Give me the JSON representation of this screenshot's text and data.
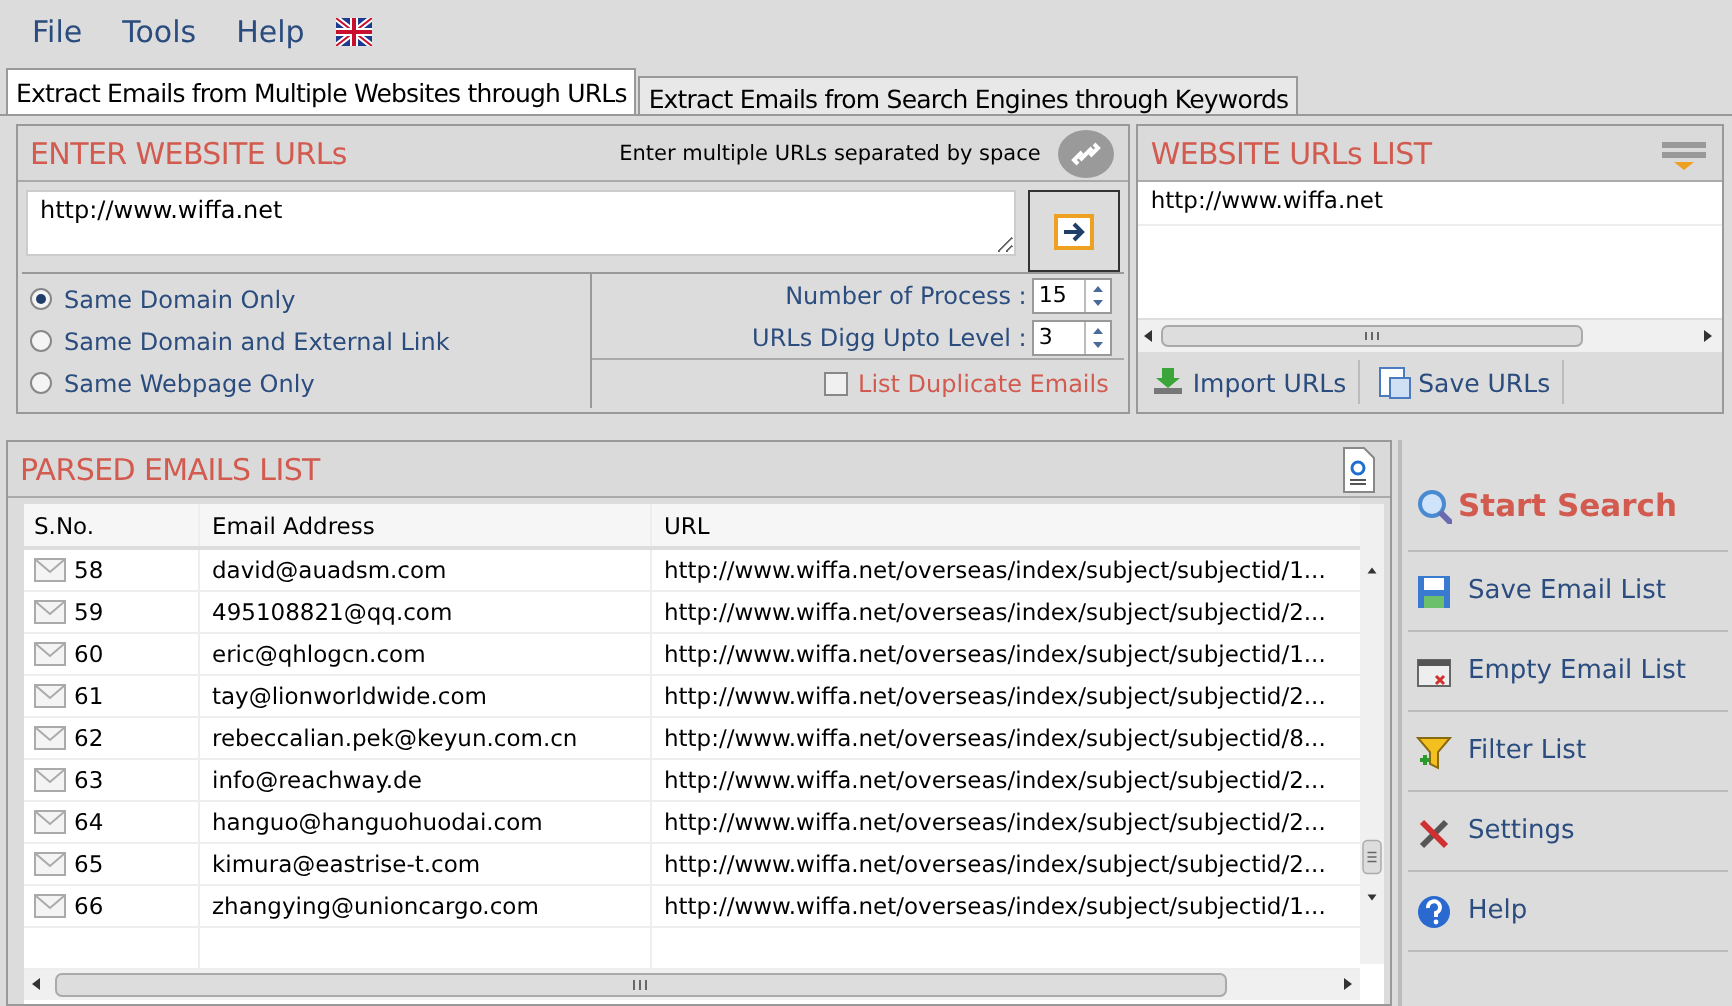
{
  "menu": [
    "File",
    "Tools",
    "Help"
  ],
  "tabs": [
    {
      "label": "Extract Emails from Multiple Websites through URLs",
      "selected": true
    },
    {
      "label": "Extract Emails from Search Engines through Keywords",
      "selected": false
    }
  ],
  "url_panel": {
    "title": "ENTER WEBSITE URLs",
    "hint": "Enter multiple URLs separated by space",
    "value": "http://www.wiffa.net"
  },
  "scope_options": [
    {
      "label": "Same Domain Only",
      "selected": true
    },
    {
      "label": "Same Domain and External Link",
      "selected": false
    },
    {
      "label": "Same Webpage Only",
      "selected": false
    }
  ],
  "spinners": [
    {
      "label": "Number of Process :",
      "value": "15"
    },
    {
      "label": "URLs Digg Upto Level :",
      "value": "3"
    }
  ],
  "list_duplicate": {
    "label": "List Duplicate Emails",
    "checked": false
  },
  "url_list": {
    "title": "WEBSITE URLs LIST",
    "items": [
      "http://www.wiffa.net"
    ],
    "buttons": [
      {
        "label": "Import URLs",
        "kind": "import"
      },
      {
        "label": "Save URLs",
        "kind": "save"
      }
    ]
  },
  "emails": {
    "title": "PARSED EMAILS LIST",
    "columns": [
      "S.No.",
      "Email Address",
      "URL"
    ],
    "rows": [
      {
        "sno": "58",
        "email": "david@auadsm.com",
        "url": "http://www.wiffa.net/overseas/index/subject/subjectid/1..."
      },
      {
        "sno": "59",
        "email": "495108821@qq.com",
        "url": "http://www.wiffa.net/overseas/index/subject/subjectid/2..."
      },
      {
        "sno": "60",
        "email": "eric@qhlogcn.com",
        "url": "http://www.wiffa.net/overseas/index/subject/subjectid/1..."
      },
      {
        "sno": "61",
        "email": "tay@lionworldwide.com",
        "url": "http://www.wiffa.net/overseas/index/subject/subjectid/2..."
      },
      {
        "sno": "62",
        "email": "rebeccalian.pek@keyun.com.cn",
        "url": "http://www.wiffa.net/overseas/index/subject/subjectid/8..."
      },
      {
        "sno": "63",
        "email": "info@reachway.de",
        "url": "http://www.wiffa.net/overseas/index/subject/subjectid/2..."
      },
      {
        "sno": "64",
        "email": "hanguo@hanguohuodai.com",
        "url": "http://www.wiffa.net/overseas/index/subject/subjectid/2..."
      },
      {
        "sno": "65",
        "email": "kimura@eastrise-t.com",
        "url": "http://www.wiffa.net/overseas/index/subject/subjectid/2..."
      },
      {
        "sno": "66",
        "email": "zhangying@unioncargo.com",
        "url": "http://www.wiffa.net/overseas/index/subject/subjectid/1..."
      }
    ]
  },
  "sidebar": [
    {
      "label": "Start Search",
      "kind": "search"
    },
    {
      "label": "Save Email List",
      "kind": "save"
    },
    {
      "label": "Empty Email List",
      "kind": "empty"
    },
    {
      "label": "Filter List",
      "kind": "filter"
    },
    {
      "label": "Settings",
      "kind": "settings"
    },
    {
      "label": "Help",
      "kind": "help"
    }
  ]
}
